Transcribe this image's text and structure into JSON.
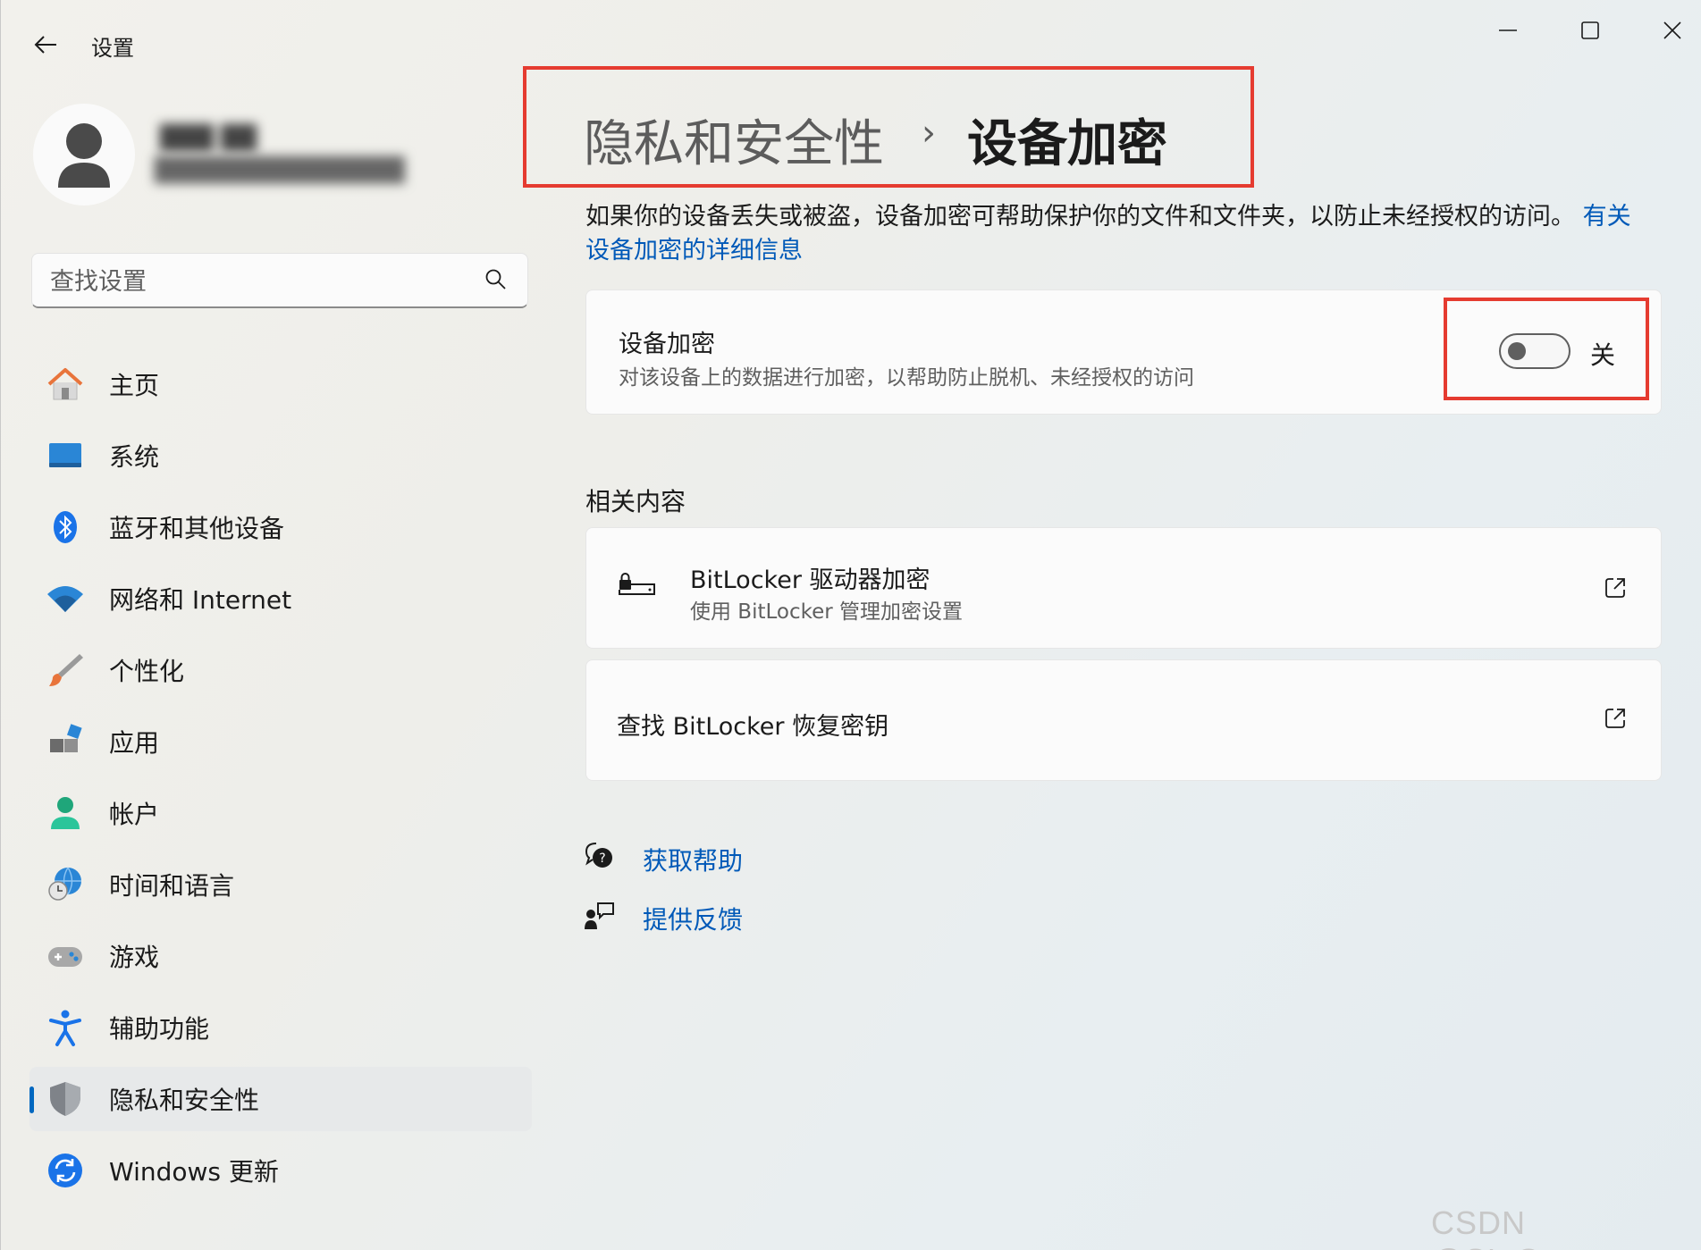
{
  "titlebar": {
    "app_title": "设置",
    "back_icon": "arrow-left-icon",
    "minimize_icon": "minimize-icon",
    "maximize_icon": "maximize-icon",
    "close_icon": "close-icon"
  },
  "user": {
    "name": "███ ██",
    "email": "██████████████",
    "avatar_icon": "person-icon"
  },
  "search": {
    "placeholder": "查找设置",
    "icon": "search-icon"
  },
  "nav": {
    "items": [
      {
        "label": "主页",
        "icon": "home-icon"
      },
      {
        "label": "系统",
        "icon": "monitor-icon"
      },
      {
        "label": "蓝牙和其他设备",
        "icon": "bluetooth-icon"
      },
      {
        "label": "网络和 Internet",
        "icon": "wifi-icon"
      },
      {
        "label": "个性化",
        "icon": "brush-icon"
      },
      {
        "label": "应用",
        "icon": "apps-icon"
      },
      {
        "label": "帐户",
        "icon": "account-icon"
      },
      {
        "label": "时间和语言",
        "icon": "globe-clock-icon"
      },
      {
        "label": "游戏",
        "icon": "gamepad-icon"
      },
      {
        "label": "辅助功能",
        "icon": "accessibility-icon"
      },
      {
        "label": "隐私和安全性",
        "icon": "shield-icon"
      },
      {
        "label": "Windows 更新",
        "icon": "update-icon"
      }
    ],
    "selected_index": 10
  },
  "breadcrumb": {
    "parent": "隐私和安全性",
    "separator": "›",
    "current": "设备加密"
  },
  "description": {
    "text": "如果你的设备丢失或被盗，设备加密可帮助保护你的文件和文件夹，以防止未经授权的访问。",
    "link_text": "有关设备加密的详细信息"
  },
  "encryption_card": {
    "title": "设备加密",
    "subtitle": "对该设备上的数据进行加密，以帮助防止脱机、未经授权的访问",
    "toggle_state": "关",
    "toggle_on": false
  },
  "related": {
    "title": "相关内容",
    "items": [
      {
        "title": "BitLocker 驱动器加密",
        "subtitle": "使用 BitLocker 管理加密设置",
        "icon": "bitlocker-drive-icon",
        "action_icon": "open-external-icon"
      },
      {
        "title": "查找 BitLocker 恢复密钥",
        "action_icon": "open-external-icon"
      }
    ]
  },
  "help": {
    "get_help": "获取帮助",
    "feedback": "提供反馈",
    "get_help_icon": "help-chat-icon",
    "feedback_icon": "feedback-icon"
  },
  "watermark": "CSDN @SI_Gamer",
  "colors": {
    "accent": "#0067c0",
    "link": "#0059b8",
    "highlight_box": "#e53b30"
  }
}
